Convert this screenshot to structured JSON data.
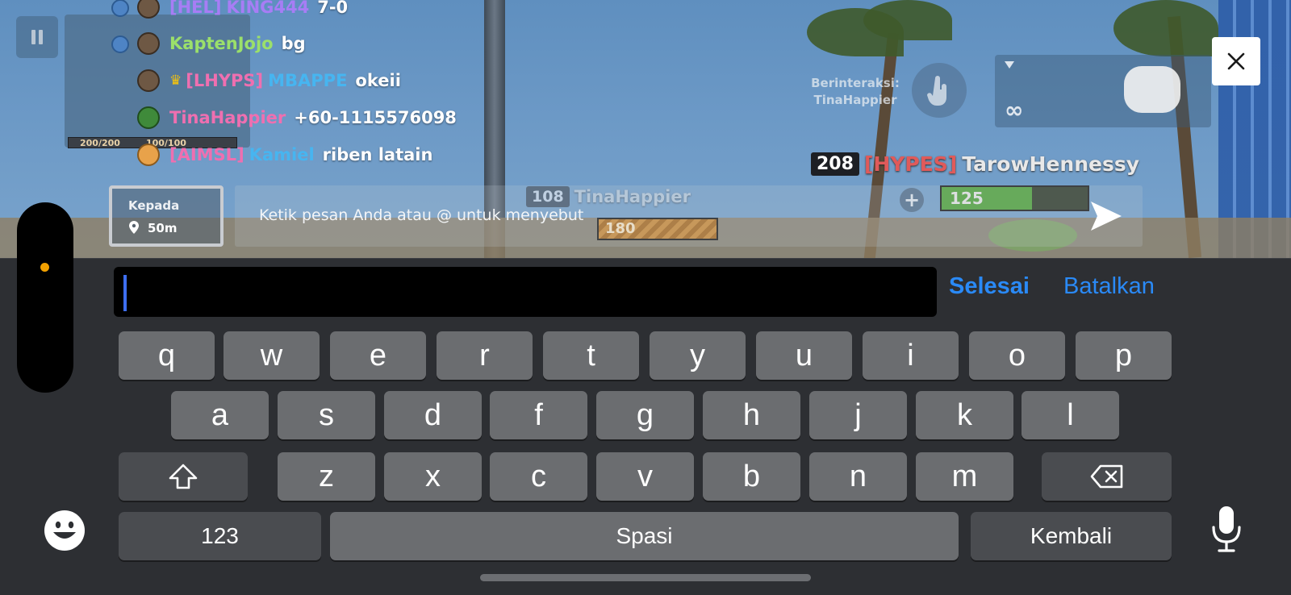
{
  "chat": {
    "messages": [
      {
        "clan": "[HEL]",
        "name": "KING444",
        "text": "7-0",
        "clan_color": "#a77df5",
        "name_color": "#a77df5"
      },
      {
        "clan": "",
        "name": "KaptenJojo",
        "text": "bg",
        "clan_color": "#9be06a",
        "name_color": "#9be06a"
      },
      {
        "clan": "[LHYPS]",
        "name": "MBAPPE",
        "text": "okeii",
        "clan_color": "#ef6fb0",
        "name_color": "#47b5f0"
      },
      {
        "clan": "",
        "name": "TinaHappier",
        "text": "+60-1115576098",
        "clan_color": "#ef6fb0",
        "name_color": "#ef6fb0"
      },
      {
        "clan": "[AIMSL]",
        "name": "Kamiel",
        "text": "riben latain",
        "clan_color": "#ef6fb0",
        "name_color": "#47b5f0"
      }
    ]
  },
  "recipient": {
    "label": "Kepada",
    "distance": "50m"
  },
  "message_bar": {
    "placeholder": "Ketik pesan Anda atau @ untuk menyebut"
  },
  "interaction": {
    "label": "Berinteraksi:",
    "target": "TinaHappier"
  },
  "emote_panel": {
    "infinity": "∞"
  },
  "player_tag": {
    "level": "208",
    "clan": "[HYPES]",
    "name": "TarowHennessy",
    "health": "125",
    "health_fraction": 0.62
  },
  "npc_tag": {
    "level": "108",
    "name": "TinaHappier",
    "health": "180"
  },
  "hud_bars": {
    "left_a": "200/200",
    "left_b": "100/100"
  },
  "keyboard": {
    "done_label": "Selesai",
    "cancel_label": "Batalkan",
    "row1": [
      "q",
      "w",
      "e",
      "r",
      "t",
      "y",
      "u",
      "i",
      "o",
      "p"
    ],
    "row2": [
      "a",
      "s",
      "d",
      "f",
      "g",
      "h",
      "j",
      "k",
      "l"
    ],
    "row3": [
      "z",
      "x",
      "c",
      "v",
      "b",
      "n",
      "m"
    ],
    "numbers_label": "123",
    "space_label": "Spasi",
    "return_label": "Kembali"
  },
  "colors": {
    "accent": "#2a8af7",
    "caret": "#3e6ef0",
    "indicator": "#f2a100"
  }
}
